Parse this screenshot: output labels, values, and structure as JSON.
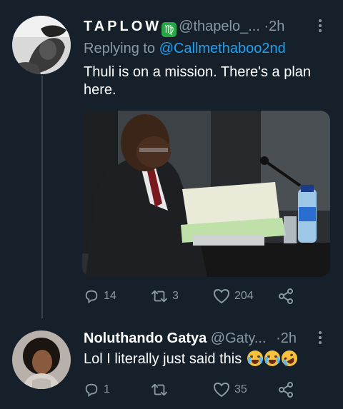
{
  "tweets": [
    {
      "display_name": "TAPLOW",
      "zodiac_badge": "♍",
      "handle": "@thapelo_...",
      "separator": "·",
      "time": "2h",
      "replying_prefix": "Replying to",
      "replying_to": "@Callmethaboo2nd",
      "text": "Thuli is on a mission. There's a plan here.",
      "actions": {
        "replies": "14",
        "retweets": "3",
        "likes": "204"
      }
    },
    {
      "display_name": "Noluthando Gatya",
      "handle": "@Gaty...",
      "separator": "·",
      "time": "2h",
      "text": "Lol I literally just said this",
      "emojis": [
        "loudly-crying-face",
        "loudly-crying-face",
        "rolling-on-floor-laughing-face"
      ],
      "actions": {
        "replies": "1",
        "retweets": "",
        "likes": "35"
      }
    }
  ],
  "colors": {
    "background": "#15202b",
    "muted": "#8899a6",
    "link": "#1da1f2",
    "divider": "#38444d",
    "badge": "#28a745"
  }
}
